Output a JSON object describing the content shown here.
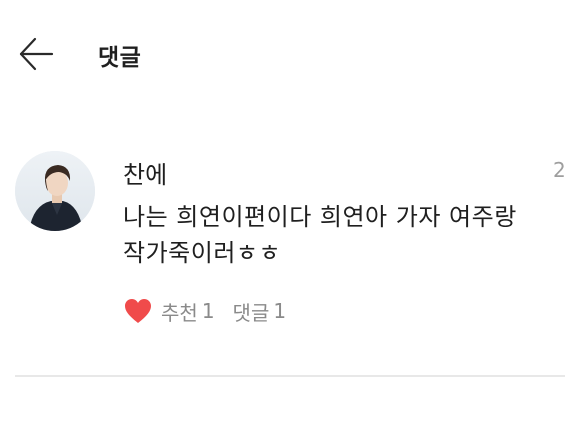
{
  "header": {
    "title": "댓글",
    "back_icon": "arrow-left-icon"
  },
  "comment": {
    "author": "찬에",
    "timestamp": "2",
    "text": "나는 희연이편이다 희연아 가자 여주랑\n작가죽이러ㅎㅎ",
    "avatar_icon": "user-avatar",
    "likes": {
      "icon": "heart-icon",
      "color": "#f04b4b",
      "label": "추천",
      "count": "1"
    },
    "replies": {
      "label": "댓글",
      "count": "1"
    }
  },
  "colors": {
    "background": "#ffffff",
    "text": "#1f1f1f",
    "muted": "#8a8a8a",
    "divider": "#e8e8e8",
    "heart": "#f04b4b"
  }
}
